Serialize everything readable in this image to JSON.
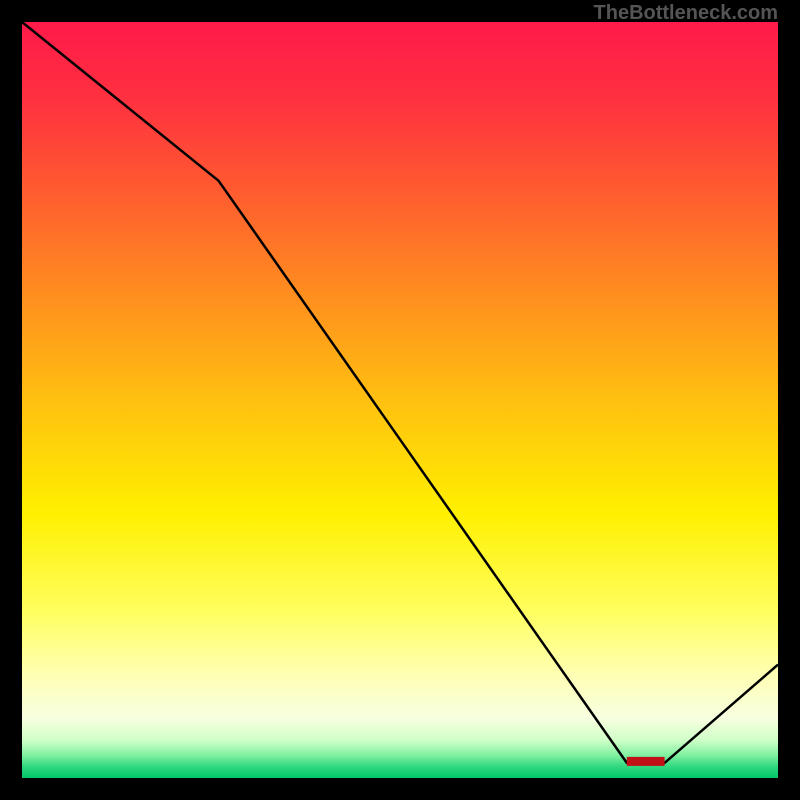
{
  "watermark": "TheBottleneck.com",
  "marker_label": "",
  "chart_data": {
    "type": "line",
    "title": "",
    "xlabel": "",
    "ylabel": "",
    "x": [
      0,
      26,
      80,
      85,
      100
    ],
    "values": [
      100,
      79,
      2,
      2,
      15
    ],
    "ylim": [
      0,
      100
    ],
    "xlim": [
      0,
      100
    ],
    "notes": "Background is a vertical spectral gradient from red (top) through orange, yellow, pale-yellow to green (bottom). A small red marker band sits near the curve minimum around x≈80-85%, y≈2."
  },
  "gradient_stops": [
    {
      "offset": "0%",
      "color": "#ff1a4a"
    },
    {
      "offset": "10%",
      "color": "#ff3040"
    },
    {
      "offset": "22%",
      "color": "#ff5a30"
    },
    {
      "offset": "35%",
      "color": "#ff8a20"
    },
    {
      "offset": "50%",
      "color": "#ffc010"
    },
    {
      "offset": "65%",
      "color": "#fff000"
    },
    {
      "offset": "78%",
      "color": "#ffff60"
    },
    {
      "offset": "86%",
      "color": "#ffffb0"
    },
    {
      "offset": "92%",
      "color": "#f8ffe0"
    },
    {
      "offset": "95%",
      "color": "#d0ffc8"
    },
    {
      "offset": "97%",
      "color": "#80f0a0"
    },
    {
      "offset": "98.5%",
      "color": "#30d880"
    },
    {
      "offset": "100%",
      "color": "#00c86a"
    }
  ]
}
